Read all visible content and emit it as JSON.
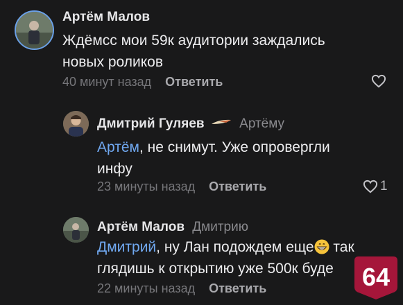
{
  "comments": [
    {
      "author": "Артём Малов",
      "text_lines": [
        "Ждёмсс мои 59к аудитории заждались",
        "новых роликов"
      ],
      "time": "40 минут назад",
      "reply_label": "Ответить"
    },
    {
      "author": "Дмитрий Гуляев",
      "reply_to": "Артёму",
      "mention": "Артём",
      "text_rest_1": ", не снимут. Уже опровергли",
      "text_line_2": "инфу",
      "time": "23 минуты назад",
      "reply_label": "Ответить",
      "likes": "1"
    },
    {
      "author": "Артём Малов",
      "reply_to": "Дмитрию",
      "mention": "Дмитрий",
      "text_rest_1": ", ну Лан подождем еще",
      "text_rest_1b": " так",
      "text_line_2": "глядишь к открытию уже 500к буде",
      "time": "22 минуты назад",
      "reply_label": "Ответить"
    }
  ],
  "badge": {
    "text": "64",
    "color": "#a5163a"
  },
  "icons": {
    "like": "heart-icon",
    "verified": "quill-icon",
    "emoji": "grinning-face-emoji"
  },
  "colors": {
    "background": "#19191a",
    "mention": "#70a8f0"
  }
}
